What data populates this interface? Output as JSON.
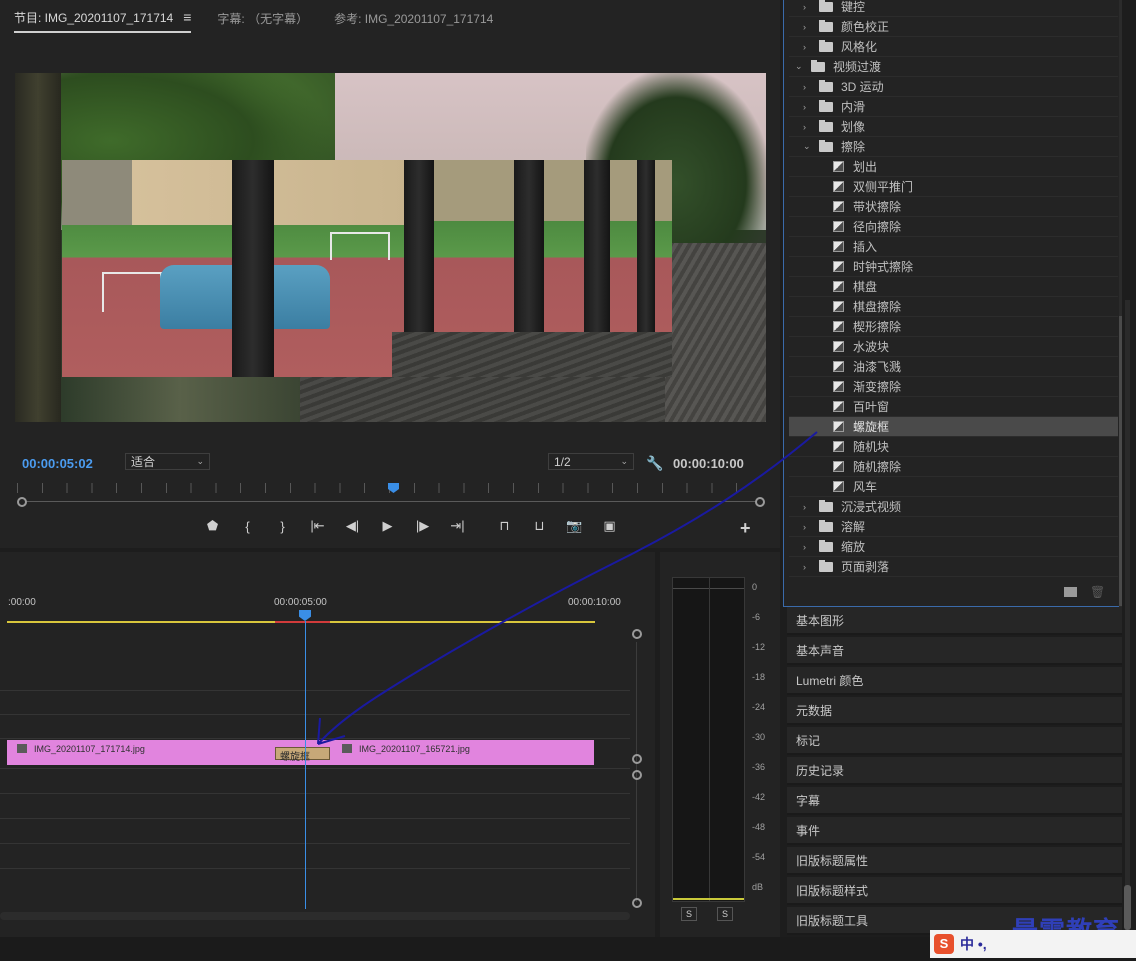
{
  "monitor": {
    "tabs": [
      {
        "label": "节目: IMG_20201107_171714",
        "active": true
      },
      {
        "label": "字幕: （无字幕）",
        "active": false
      },
      {
        "label": "参考: IMG_20201107_171714",
        "active": false
      }
    ],
    "tab_menu_icon": "≡",
    "current_timecode": "00:00:05:02",
    "duration_timecode": "00:00:10:00",
    "fit_select": "适合",
    "resolution_select": "1/2",
    "transport_icons": [
      "marker-icon",
      "mark-in-icon",
      "mark-out-icon",
      "go-to-in-icon",
      "step-back-icon",
      "play-icon",
      "step-forward-icon",
      "go-to-out-icon",
      "lift-icon",
      "extract-icon",
      "export-frame-icon",
      "compare-icon"
    ],
    "transport_glyphs": [
      "⬟",
      "{",
      "}",
      "|⇤",
      "◀|",
      "▶",
      "|▶",
      "⇥|",
      "⊓",
      "⊔",
      "📷",
      "▣"
    ],
    "add_button": "+"
  },
  "timeline": {
    "ruler_labels": [
      ":00:00",
      "00:00:05:00",
      "00:00:10:00"
    ],
    "clips": [
      {
        "name": "IMG_20201107_171714.jpg"
      },
      {
        "name": "IMG_20201107_165721.jpg"
      }
    ],
    "transition_label": "螺旋框"
  },
  "audio_meter": {
    "db_labels": [
      "0",
      "-6",
      "-12",
      "-18",
      "-24",
      "-30",
      "-36",
      "-42",
      "-48",
      "-54",
      "dB"
    ],
    "solo_buttons": [
      "S",
      "S"
    ]
  },
  "effects": {
    "rows": [
      {
        "label": "键控",
        "kind": "folder",
        "depth": 1,
        "expanded": false
      },
      {
        "label": "颜色校正",
        "kind": "folder",
        "depth": 1,
        "expanded": false
      },
      {
        "label": "风格化",
        "kind": "folder",
        "depth": 1,
        "expanded": false
      },
      {
        "label": "视频过渡",
        "kind": "folder",
        "depth": 0,
        "expanded": true
      },
      {
        "label": "3D 运动",
        "kind": "folder",
        "depth": 1,
        "expanded": false
      },
      {
        "label": "内滑",
        "kind": "folder",
        "depth": 1,
        "expanded": false
      },
      {
        "label": "划像",
        "kind": "folder",
        "depth": 1,
        "expanded": false
      },
      {
        "label": "擦除",
        "kind": "folder",
        "depth": 1,
        "expanded": true
      },
      {
        "label": "划出",
        "kind": "effect",
        "depth": 2
      },
      {
        "label": "双侧平推门",
        "kind": "effect",
        "depth": 2
      },
      {
        "label": "带状擦除",
        "kind": "effect",
        "depth": 2
      },
      {
        "label": "径向擦除",
        "kind": "effect",
        "depth": 2
      },
      {
        "label": "插入",
        "kind": "effect",
        "depth": 2
      },
      {
        "label": "时钟式擦除",
        "kind": "effect",
        "depth": 2
      },
      {
        "label": "棋盘",
        "kind": "effect",
        "depth": 2
      },
      {
        "label": "棋盘擦除",
        "kind": "effect",
        "depth": 2
      },
      {
        "label": "楔形擦除",
        "kind": "effect",
        "depth": 2
      },
      {
        "label": "水波块",
        "kind": "effect",
        "depth": 2
      },
      {
        "label": "油漆飞溅",
        "kind": "effect",
        "depth": 2
      },
      {
        "label": "渐变擦除",
        "kind": "effect",
        "depth": 2
      },
      {
        "label": "百叶窗",
        "kind": "effect",
        "depth": 2
      },
      {
        "label": "螺旋框",
        "kind": "effect",
        "depth": 2,
        "selected": true
      },
      {
        "label": "随机块",
        "kind": "effect",
        "depth": 2
      },
      {
        "label": "随机擦除",
        "kind": "effect",
        "depth": 2
      },
      {
        "label": "风车",
        "kind": "effect",
        "depth": 2
      },
      {
        "label": "沉浸式视频",
        "kind": "folder",
        "depth": 1,
        "expanded": false
      },
      {
        "label": "溶解",
        "kind": "folder",
        "depth": 1,
        "expanded": false
      },
      {
        "label": "缩放",
        "kind": "folder",
        "depth": 1,
        "expanded": false
      },
      {
        "label": "页面剥落",
        "kind": "folder",
        "depth": 1,
        "expanded": false
      }
    ]
  },
  "panels": [
    "基本图形",
    "基本声音",
    "Lumetri 颜色",
    "元数据",
    "标记",
    "历史记录",
    "字幕",
    "事件",
    "旧版标题属性",
    "旧版标题样式",
    "旧版标题工具"
  ],
  "ime": {
    "logo": "S",
    "mode": "中 •,"
  },
  "watermark": "最需教育",
  "colors": {
    "accent": "#3a8ee6",
    "clip": "#e184de",
    "transition": "#c7a878",
    "drag_arrow": "#1a1aa0"
  }
}
